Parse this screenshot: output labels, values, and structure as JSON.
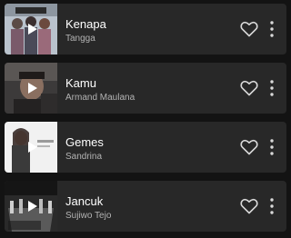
{
  "tracks": [
    {
      "title": "Kenapa",
      "artist": "Tangga"
    },
    {
      "title": "Kamu",
      "artist": "Armand Maulana"
    },
    {
      "title": "Gemes",
      "artist": "Sandrina"
    },
    {
      "title": "Jancuk",
      "artist": "Sujiwo Tejo"
    }
  ],
  "colors": {
    "background": "#131313",
    "card": "#282828",
    "title": "#ffffff",
    "subtitle": "#b3b3b3",
    "icon": "#d9d9d9"
  },
  "icons": {
    "play": "play-icon",
    "like": "heart-outline-icon",
    "more": "more-vertical-icon"
  }
}
